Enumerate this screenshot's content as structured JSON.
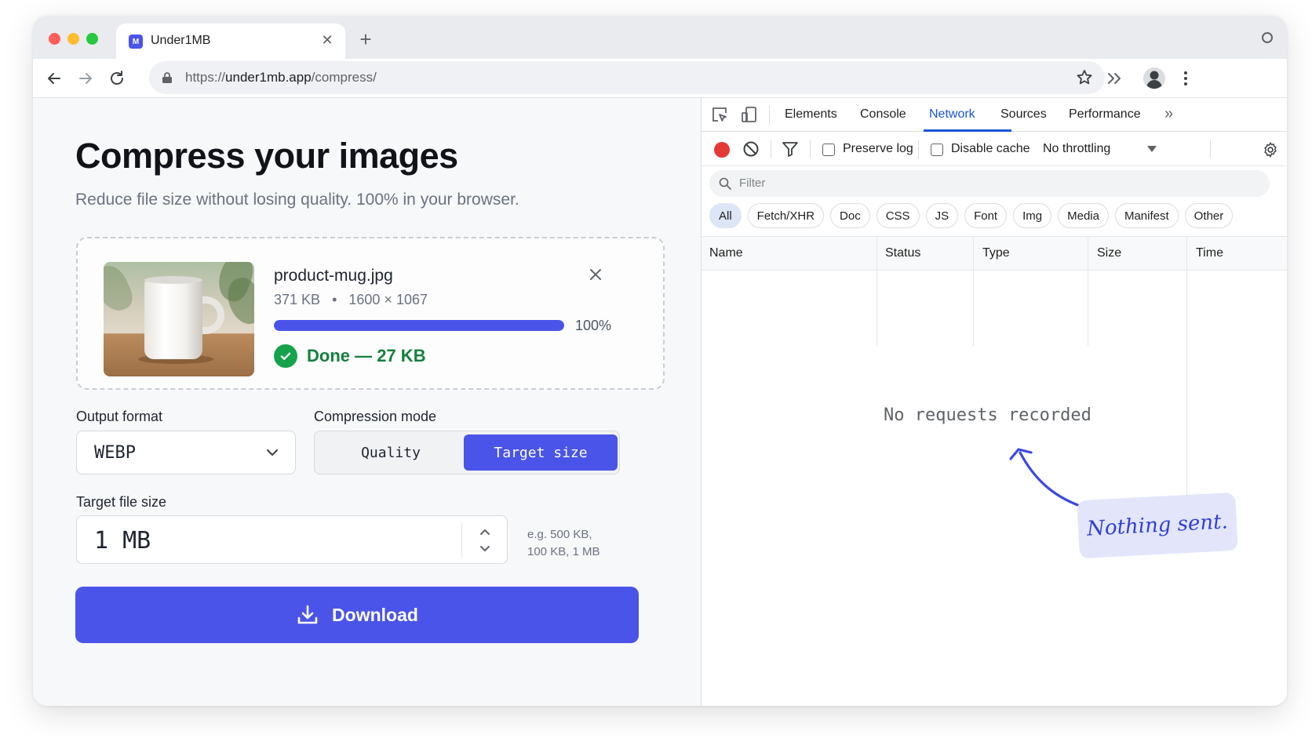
{
  "browser": {
    "tab_title": "Under1MB",
    "favicon_letter": "M",
    "url_prefix": "https://",
    "url_host": "under1mb.app",
    "url_path": "/compress/"
  },
  "app": {
    "title": "Compress your images",
    "subtitle": "Reduce file size without losing quality. 100% in your browser.",
    "file": {
      "name": "product-mug.jpg",
      "size": "371 KB",
      "separator": "•",
      "dimensions": "1600 × 1067",
      "progress_percent": 100,
      "progress_label": "100%",
      "status": "Done — 27 KB"
    },
    "output_format": {
      "label": "Output format",
      "value": "WEBP"
    },
    "compression_mode": {
      "label": "Compression mode",
      "options": [
        "Quality",
        "Target size"
      ],
      "selected": "Target size"
    },
    "target_size": {
      "label": "Target file size",
      "value": "1 MB",
      "hint_line1": "e.g. 500 KB,",
      "hint_line2": "100 KB, 1 MB"
    },
    "download_label": "Download"
  },
  "devtools": {
    "tabs": [
      "Elements",
      "Console",
      "Network",
      "Sources",
      "Performance"
    ],
    "active_tab": "Network",
    "more": "»",
    "preserve_log": "Preserve log",
    "disable_cache": "Disable cache",
    "throttling": "No throttling",
    "filter_placeholder": "Filter",
    "filter_types": [
      "All",
      "Fetch/XHR",
      "Doc",
      "CSS",
      "JS",
      "Font",
      "Img",
      "Media",
      "Manifest",
      "Other"
    ],
    "columns": [
      "Name",
      "Status",
      "Type",
      "Size",
      "Time"
    ],
    "empty_message": "No requests recorded",
    "annotation": "Nothing sent."
  },
  "colors": {
    "accent": "#4a54e8",
    "success": "#15803d",
    "devtools_blue": "#1a56db",
    "record_red": "#e53935"
  }
}
